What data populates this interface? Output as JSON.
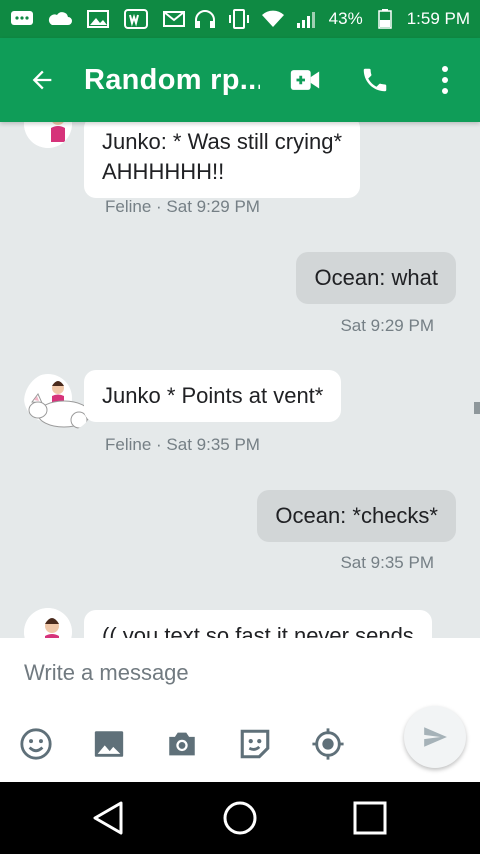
{
  "status_bar": {
    "battery": "43%",
    "time": "1:59 PM",
    "icons": [
      "chat-bubble-icon",
      "cloud-icon",
      "image-icon",
      "word-icon",
      "gmail-icon",
      "headphones-icon",
      "vibrate-icon",
      "wifi-icon",
      "signal-icon",
      "battery-icon"
    ]
  },
  "app_bar": {
    "title": "Random rp...",
    "icons": [
      "back-arrow-icon",
      "video-call-icon",
      "phone-icon",
      "more-vert-icon"
    ]
  },
  "messages": [
    {
      "direction": "incoming",
      "text_lines": [
        "Junko: * Was still crying*",
        "AHHHHHH!!"
      ],
      "sender": "Feline",
      "time": "Sat 9:29 PM"
    },
    {
      "direction": "outgoing",
      "text_lines": [
        "Ocean: what"
      ],
      "time": "Sat 9:29 PM"
    },
    {
      "direction": "incoming",
      "text_lines": [
        "Junko * Points at vent*"
      ],
      "sender": "Feline",
      "time": "Sat 9:35 PM"
    },
    {
      "direction": "outgoing",
      "text_lines": [
        "Ocean: *checks*"
      ],
      "time": "Sat 9:35 PM"
    },
    {
      "direction": "incoming",
      "text_lines": [
        "(( you text so fast it never sends"
      ]
    }
  ],
  "compose": {
    "placeholder": "Write a message",
    "icons": [
      "emoji-icon",
      "gallery-icon",
      "camera-icon",
      "sticker-icon",
      "location-icon",
      "send-icon"
    ]
  },
  "nav_bar": {
    "icons": [
      "nav-back-icon",
      "nav-home-icon",
      "nav-recents-icon"
    ]
  },
  "colors": {
    "status_bar": "#0f8a43",
    "app_bar": "#0f9d58",
    "conversation_bg": "#e5e9ea",
    "incoming_bubble": "#ffffff",
    "outgoing_bubble": "#d2d6d7"
  }
}
